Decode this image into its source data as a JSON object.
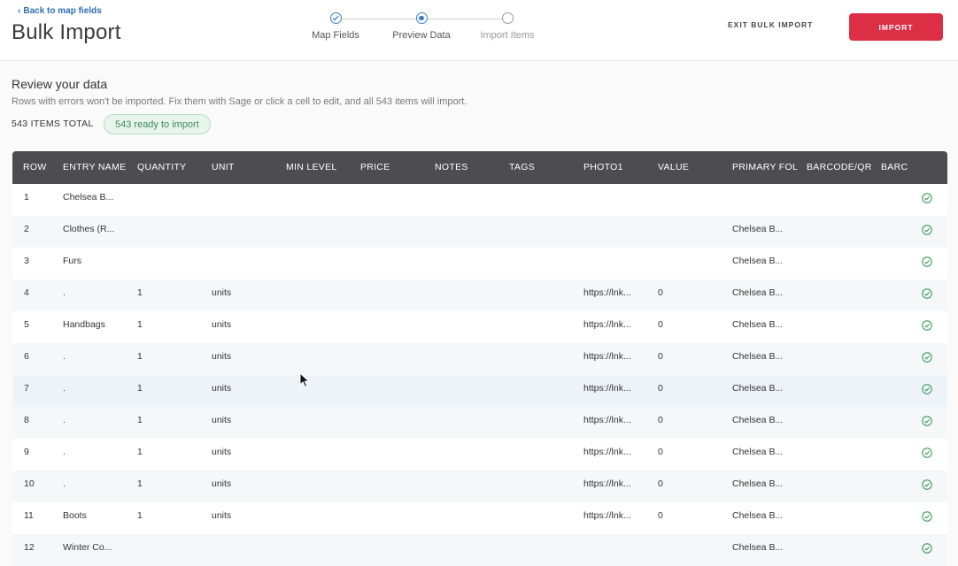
{
  "header": {
    "back_label": "Back to map fields",
    "title": "Bulk Import",
    "exit_label": "EXIT BULK IMPORT",
    "import_label": "IMPORT"
  },
  "stepper": {
    "steps": [
      {
        "label": "Map Fields",
        "state": "done"
      },
      {
        "label": "Preview Data",
        "state": "active"
      },
      {
        "label": "Import Items",
        "state": "pending"
      }
    ]
  },
  "review": {
    "title": "Review your data",
    "subtitle": "Rows with errors won't be imported. Fix them with Sage or click a cell to edit, and all 543 items will import.",
    "total_label": "543 ITEMS TOTAL",
    "ready_badge": "543 ready to import"
  },
  "table": {
    "columns": [
      "ROW",
      "ENTRY NAME",
      "QUANTITY",
      "UNIT",
      "MIN LEVEL",
      "PRICE",
      "NOTES",
      "TAGS",
      "PHOTO1",
      "VALUE",
      "PRIMARY FOLI",
      "BARCODE/QR",
      "BARC"
    ],
    "rows": [
      {
        "row": "1",
        "name": "Chelsea B...",
        "quantity": "",
        "unit": "",
        "photo": "",
        "value": "",
        "folder": ""
      },
      {
        "row": "2",
        "name": "Clothes (R...",
        "quantity": "",
        "unit": "",
        "photo": "",
        "value": "",
        "folder": "Chelsea B..."
      },
      {
        "row": "3",
        "name": "Furs",
        "quantity": "",
        "unit": "",
        "photo": "",
        "value": "",
        "folder": "Chelsea B..."
      },
      {
        "row": "4",
        "name": ".",
        "quantity": "1",
        "unit": "units",
        "photo": "https://lnk...",
        "value": "0",
        "folder": "Chelsea B..."
      },
      {
        "row": "5",
        "name": "Handbags",
        "quantity": "1",
        "unit": "units",
        "photo": "https://lnk...",
        "value": "0",
        "folder": "Chelsea B..."
      },
      {
        "row": "6",
        "name": ".",
        "quantity": "1",
        "unit": "units",
        "photo": "https://lnk...",
        "value": "0",
        "folder": "Chelsea B..."
      },
      {
        "row": "7",
        "name": ".",
        "quantity": "1",
        "unit": "units",
        "photo": "https://lnk...",
        "value": "0",
        "folder": "Chelsea B..."
      },
      {
        "row": "8",
        "name": ".",
        "quantity": "1",
        "unit": "units",
        "photo": "https://lnk...",
        "value": "0",
        "folder": "Chelsea B..."
      },
      {
        "row": "9",
        "name": ".",
        "quantity": "1",
        "unit": "units",
        "photo": "https://lnk...",
        "value": "0",
        "folder": "Chelsea B..."
      },
      {
        "row": "10",
        "name": ".",
        "quantity": "1",
        "unit": "units",
        "photo": "https://lnk...",
        "value": "0",
        "folder": "Chelsea B..."
      },
      {
        "row": "11",
        "name": "Boots",
        "quantity": "1",
        "unit": "units",
        "photo": "https://lnk...",
        "value": "0",
        "folder": "Chelsea B..."
      },
      {
        "row": "12",
        "name": "Winter Co...",
        "quantity": "",
        "unit": "",
        "photo": "",
        "value": "",
        "folder": "Chelsea B..."
      }
    ],
    "status_icon": "check-circle-icon",
    "status_color": "#3f9a5f"
  },
  "colors": {
    "accent": "#3b7fc4",
    "import_button": "#dc2f45",
    "header_bar": "#4d4d51"
  }
}
